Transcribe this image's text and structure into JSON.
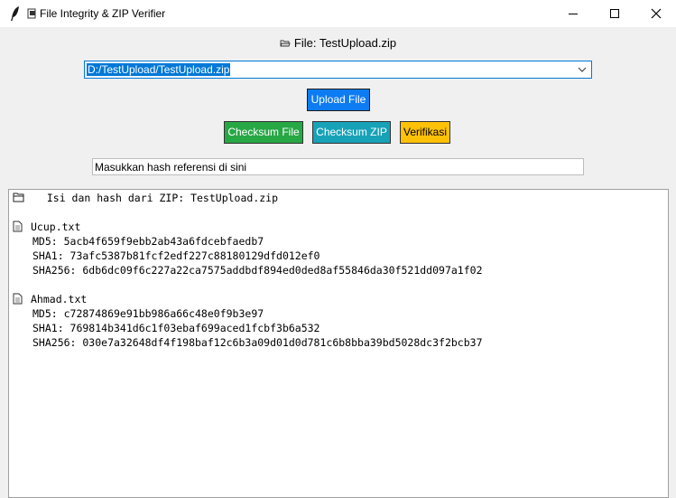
{
  "window": {
    "title": "File Integrity & ZIP Verifier"
  },
  "header": {
    "file_label": "File: TestUpload.zip"
  },
  "combo": {
    "value": "D:/TestUpload/TestUpload.zip"
  },
  "buttons": {
    "upload": "Upload File",
    "checksum_file": "Checksum File",
    "checksum_zip": "Checksum ZIP",
    "verify": "Verifikasi"
  },
  "hash_input": {
    "value": "Masukkan hash referensi di sini"
  },
  "output": {
    "heading": "  Isi dan hash dari ZIP: TestUpload.zip",
    "files": [
      {
        "name": "Ucup.txt",
        "md5": "MD5: 5acb4f659f9ebb2ab43a6fdcebfaedb7",
        "sha1": "SHA1: 73afc5387b81fcf2edf227c88180129dfd012ef0",
        "sha256": "SHA256: 6db6dc09f6c227a22ca7575addbdf894ed0ded8af55846da30f521dd097a1f02"
      },
      {
        "name": "Ahmad.txt",
        "md5": "MD5: c72874869e91bb986a66c48e0f9b3e97",
        "sha1": "SHA1: 769814b341d6c1f03ebaf699aced1fcbf3b6a532",
        "sha256": "SHA256: 030e7a32648df4f198baf12c6b3a09d01d0d781c6b8bba39bd5028dc3f2bcb37"
      }
    ]
  }
}
